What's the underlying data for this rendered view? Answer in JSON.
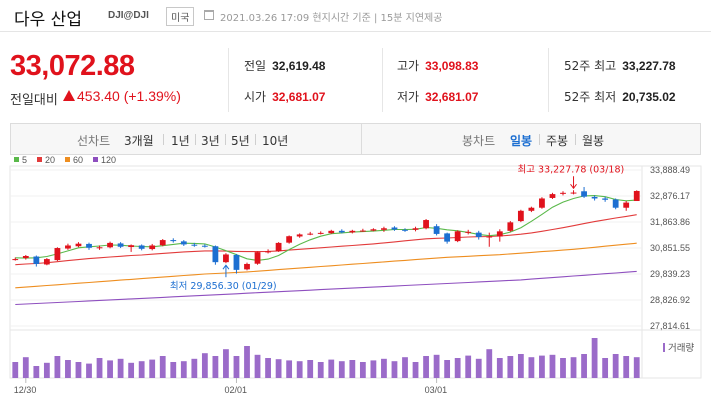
{
  "header": {
    "name": "다우 산업",
    "code": "DJI@DJI",
    "market": "미국",
    "time": "2021.03.26 17:09 현지시간 기준 | 15분 지연제공"
  },
  "price": {
    "current": "33,072.88",
    "change_label": "전일대비",
    "change": "453.40 (+1.39%)"
  },
  "stats": {
    "prev_close": {
      "label": "전일",
      "value": "32,619.48"
    },
    "open": {
      "label": "시가",
      "value": "32,681.07"
    },
    "high": {
      "label": "고가",
      "value": "33,098.83"
    },
    "low": {
      "label": "저가",
      "value": "32,681.07"
    },
    "high52": {
      "label": "52주 최고",
      "value": "33,227.78"
    },
    "low52": {
      "label": "52주 최저",
      "value": "20,735.02"
    }
  },
  "toolbar": {
    "line_label": "선차트",
    "periods": [
      "3개월",
      "1년",
      "3년",
      "5년",
      "10년"
    ],
    "candle_label": "봉차트",
    "candle_periods": [
      "일봉",
      "주봉",
      "월봉"
    ],
    "active_candle": "일봉"
  },
  "colors": {
    "up": "#e0121c",
    "down": "#1d6fd1",
    "ma5": "#5ab94a",
    "ma20": "#e23b3b",
    "ma60": "#ee8e20",
    "ma120": "#8e4fbf",
    "volume": "#9b6bc9"
  },
  "chart_data": {
    "type": "candlestick",
    "legend": [
      {
        "name": "5",
        "color": "#5ab94a"
      },
      {
        "name": "20",
        "color": "#e23b3b"
      },
      {
        "name": "60",
        "color": "#ee8e20"
      },
      {
        "name": "120",
        "color": "#8e4fbf"
      }
    ],
    "y_ticks": [
      "33,888.49",
      "32,876.17",
      "31,863.86",
      "30,851.55",
      "29,839.23",
      "28,826.92",
      "27,814.61"
    ],
    "y_range": [
      27814.61,
      33888.49
    ],
    "x_ticks": [
      {
        "label": "12/30",
        "index": 1
      },
      {
        "label": "02/01",
        "index": 21
      },
      {
        "label": "03/01",
        "index": 40
      }
    ],
    "high_note": "최고 33,227.78 (03/18)",
    "low_note": "최저 29,856.30 (01/29)",
    "high_index": 53,
    "low_index": 20,
    "volume_label": "거래량",
    "candles": [
      {
        "o": 30400,
        "c": 30420,
        "h": 30480,
        "l": 30360
      },
      {
        "o": 30460,
        "c": 30540,
        "h": 30580,
        "l": 30400
      },
      {
        "o": 30520,
        "c": 30230,
        "h": 30560,
        "l": 30130
      },
      {
        "o": 30210,
        "c": 30420,
        "h": 30460,
        "l": 30180
      },
      {
        "o": 30380,
        "c": 30850,
        "h": 30880,
        "l": 30340
      },
      {
        "o": 30830,
        "c": 30950,
        "h": 31020,
        "l": 30780
      },
      {
        "o": 30920,
        "c": 31020,
        "h": 31080,
        "l": 30880
      },
      {
        "o": 31010,
        "c": 30860,
        "h": 31060,
        "l": 30780
      },
      {
        "o": 30840,
        "c": 30880,
        "h": 30950,
        "l": 30780
      },
      {
        "o": 30880,
        "c": 31050,
        "h": 31100,
        "l": 30840
      },
      {
        "o": 31030,
        "c": 30900,
        "h": 31080,
        "l": 30850
      },
      {
        "o": 30890,
        "c": 30960,
        "h": 30990,
        "l": 30700
      },
      {
        "o": 30950,
        "c": 30820,
        "h": 30990,
        "l": 30760
      },
      {
        "o": 30810,
        "c": 30950,
        "h": 31010,
        "l": 30760
      },
      {
        "o": 30960,
        "c": 31160,
        "h": 31200,
        "l": 30920
      },
      {
        "o": 31160,
        "c": 31120,
        "h": 31230,
        "l": 31060
      },
      {
        "o": 31110,
        "c": 30990,
        "h": 31160,
        "l": 30930
      },
      {
        "o": 30980,
        "c": 30950,
        "h": 31050,
        "l": 30900
      },
      {
        "o": 30940,
        "c": 30930,
        "h": 31000,
        "l": 30870
      },
      {
        "o": 30920,
        "c": 30300,
        "h": 30950,
        "l": 30200
      },
      {
        "o": 30300,
        "c": 30600,
        "h": 30650,
        "l": 30260
      },
      {
        "o": 30580,
        "c": 30000,
        "h": 30620,
        "l": 29856
      },
      {
        "o": 30020,
        "c": 30230,
        "h": 30280,
        "l": 29980
      },
      {
        "o": 30240,
        "c": 30690,
        "h": 30720,
        "l": 30200
      },
      {
        "o": 30700,
        "c": 30720,
        "h": 30800,
        "l": 30640
      },
      {
        "o": 30730,
        "c": 31050,
        "h": 31080,
        "l": 30700
      },
      {
        "o": 31060,
        "c": 31310,
        "h": 31340,
        "l": 31020
      },
      {
        "o": 31300,
        "c": 31380,
        "h": 31420,
        "l": 31250
      },
      {
        "o": 31400,
        "c": 31410,
        "h": 31480,
        "l": 31350
      },
      {
        "o": 31420,
        "c": 31440,
        "h": 31500,
        "l": 31380
      },
      {
        "o": 31430,
        "c": 31520,
        "h": 31560,
        "l": 31400
      },
      {
        "o": 31520,
        "c": 31460,
        "h": 31580,
        "l": 31420
      },
      {
        "o": 31460,
        "c": 31520,
        "h": 31560,
        "l": 31420
      },
      {
        "o": 31520,
        "c": 31530,
        "h": 31600,
        "l": 31480
      },
      {
        "o": 31530,
        "c": 31580,
        "h": 31620,
        "l": 31500
      },
      {
        "o": 31560,
        "c": 31620,
        "h": 31680,
        "l": 31480
      },
      {
        "o": 31650,
        "c": 31570,
        "h": 31700,
        "l": 31520
      },
      {
        "o": 31560,
        "c": 31540,
        "h": 31620,
        "l": 31480
      },
      {
        "o": 31560,
        "c": 31620,
        "h": 31680,
        "l": 31500
      },
      {
        "o": 31620,
        "c": 31940,
        "h": 31980,
        "l": 31580
      },
      {
        "o": 31700,
        "c": 31400,
        "h": 31780,
        "l": 31340
      },
      {
        "o": 31420,
        "c": 31100,
        "h": 31450,
        "l": 31020
      },
      {
        "o": 31120,
        "c": 31500,
        "h": 31540,
        "l": 31080
      },
      {
        "o": 31480,
        "c": 31480,
        "h": 31560,
        "l": 31380
      },
      {
        "o": 31450,
        "c": 31280,
        "h": 31520,
        "l": 31180
      },
      {
        "o": 31260,
        "c": 31300,
        "h": 31450,
        "l": 30900
      },
      {
        "o": 31300,
        "c": 31500,
        "h": 31580,
        "l": 31100
      },
      {
        "o": 31520,
        "c": 31850,
        "h": 31900,
        "l": 31480
      },
      {
        "o": 31900,
        "c": 32300,
        "h": 32340,
        "l": 31860
      },
      {
        "o": 32300,
        "c": 32420,
        "h": 32460,
        "l": 32250
      },
      {
        "o": 32420,
        "c": 32780,
        "h": 32830,
        "l": 32380
      },
      {
        "o": 32800,
        "c": 32950,
        "h": 33000,
        "l": 32760
      },
      {
        "o": 32960,
        "c": 33000,
        "h": 33060,
        "l": 32900
      },
      {
        "o": 33000,
        "c": 33010,
        "h": 33100,
        "l": 32940
      },
      {
        "o": 33060,
        "c": 32850,
        "h": 33227,
        "l": 32800
      },
      {
        "o": 32840,
        "c": 32780,
        "h": 32900,
        "l": 32700
      },
      {
        "o": 32780,
        "c": 32730,
        "h": 32850,
        "l": 32650
      },
      {
        "o": 32740,
        "c": 32420,
        "h": 32780,
        "l": 32360
      },
      {
        "o": 32420,
        "c": 32620,
        "h": 32680,
        "l": 32300
      },
      {
        "o": 32681,
        "c": 33072,
        "h": 33098,
        "l": 32681
      }
    ],
    "ma5": [
      30470,
      30460,
      30470,
      30520,
      30620,
      30740,
      30860,
      30900,
      30930,
      30970,
      30960,
      30930,
      30910,
      30900,
      30940,
      30990,
      31040,
      31030,
      31010,
      30890,
      30750,
      30590,
      30430,
      30370,
      30420,
      30560,
      30790,
      31000,
      31170,
      31310,
      31410,
      31440,
      31470,
      31490,
      31510,
      31540,
      31570,
      31570,
      31580,
      31650,
      31620,
      31560,
      31520,
      31460,
      31380,
      31330,
      31370,
      31470,
      31640,
      31890,
      32160,
      32440,
      32640,
      32780,
      32880,
      32890,
      32850,
      32740,
      32690,
      32720
    ],
    "ma20": [
      30200,
      30230,
      30250,
      30280,
      30320,
      30360,
      30400,
      30440,
      30470,
      30500,
      30530,
      30560,
      30580,
      30610,
      30640,
      30670,
      30700,
      30720,
      30740,
      30740,
      30730,
      30720,
      30710,
      30710,
      30720,
      30740,
      30770,
      30800,
      30830,
      30860,
      30890,
      30920,
      30950,
      30980,
      31010,
      31050,
      31090,
      31130,
      31170,
      31210,
      31230,
      31240,
      31260,
      31280,
      31290,
      31300,
      31320,
      31350,
      31390,
      31440,
      31500,
      31570,
      31640,
      31720,
      31800,
      31880,
      31950,
      32020,
      32080,
      32150
    ],
    "ma60": [
      29300,
      29330,
      29360,
      29390,
      29420,
      29450,
      29480,
      29510,
      29540,
      29570,
      29600,
      29630,
      29660,
      29690,
      29720,
      29750,
      29780,
      29810,
      29840,
      29860,
      29880,
      29900,
      29920,
      29950,
      29980,
      30010,
      30040,
      30070,
      30100,
      30130,
      30160,
      30190,
      30220,
      30250,
      30280,
      30310,
      30340,
      30370,
      30400,
      30430,
      30460,
      30490,
      30510,
      30530,
      30550,
      30570,
      30590,
      30620,
      30650,
      30680,
      30710,
      30740,
      30770,
      30800,
      30840,
      30880,
      30920,
      30960,
      31000,
      31040
    ],
    "ma120": [
      28650,
      28670,
      28690,
      28710,
      28730,
      28750,
      28770,
      28790,
      28810,
      28830,
      28850,
      28870,
      28890,
      28910,
      28930,
      28950,
      28970,
      28990,
      29010,
      29030,
      29050,
      29070,
      29090,
      29110,
      29130,
      29150,
      29170,
      29190,
      29210,
      29230,
      29250,
      29270,
      29290,
      29310,
      29330,
      29350,
      29370,
      29390,
      29410,
      29430,
      29450,
      29470,
      29490,
      29510,
      29530,
      29550,
      29570,
      29590,
      29610,
      29640,
      29670,
      29700,
      29730,
      29760,
      29790,
      29820,
      29850,
      29880,
      29910,
      29940
    ],
    "volume": [
      0.4,
      0.52,
      0.3,
      0.38,
      0.55,
      0.45,
      0.4,
      0.36,
      0.5,
      0.44,
      0.48,
      0.38,
      0.42,
      0.46,
      0.55,
      0.4,
      0.42,
      0.48,
      0.62,
      0.55,
      0.72,
      0.55,
      0.8,
      0.58,
      0.5,
      0.47,
      0.44,
      0.42,
      0.45,
      0.4,
      0.46,
      0.42,
      0.45,
      0.4,
      0.44,
      0.48,
      0.42,
      0.52,
      0.4,
      0.55,
      0.58,
      0.45,
      0.5,
      0.56,
      0.48,
      0.72,
      0.5,
      0.55,
      0.6,
      0.52,
      0.56,
      0.58,
      0.5,
      0.52,
      0.6,
      1.0,
      0.5,
      0.6,
      0.55,
      0.52
    ]
  }
}
